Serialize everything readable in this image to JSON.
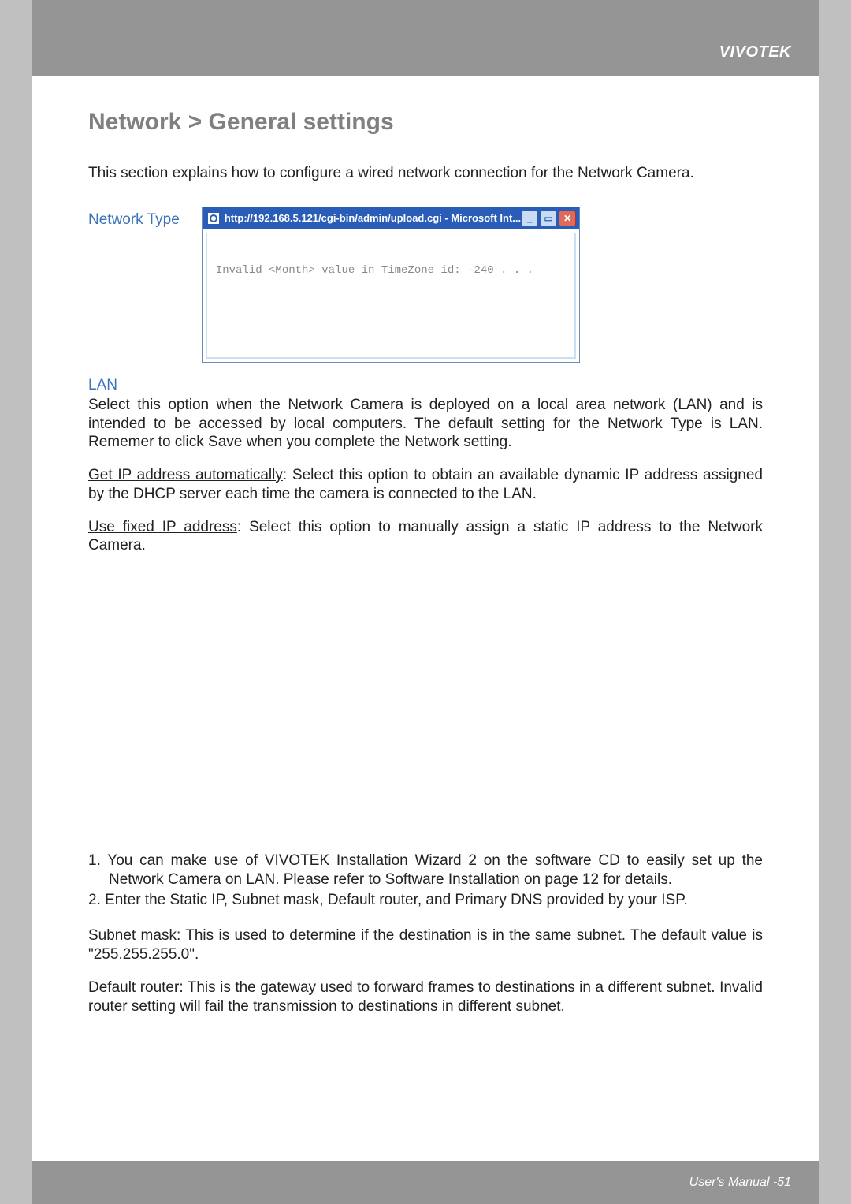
{
  "header": {
    "brand": "VIVOTEK"
  },
  "title": "Network > General settings",
  "intro": "This section explains how to configure a wired network connection for the Network Camera.",
  "network_type_label": "Network Type",
  "ie_window": {
    "title": "http://192.168.5.121/cgi-bin/admin/upload.cgi - Microsoft Int...",
    "body": "Invalid <Month> value in TimeZone id: -240 . . ."
  },
  "lan": {
    "heading": "LAN",
    "p1": "Select this option when the Network Camera is deployed on a local area network (LAN) and is intended to be accessed by local computers. The default setting for the Network Type is LAN. Rememer to click Save when you complete the Network setting.",
    "get_ip_label": "Get IP address automatically",
    "get_ip_rest": ": Select this option to obtain an available dynamic IP address assigned by the DHCP server each time the camera is connected to the LAN.",
    "fixed_ip_label": "Use fixed IP address",
    "fixed_ip_rest": ": Select this option to manually assign a static IP address to the Network Camera."
  },
  "numbered": {
    "item1": "1. You can make use of VIVOTEK Installation Wizard 2 on the software CD to easily set up the Network Camera on LAN. Please refer to Software Installation on page 12 for details.",
    "item2": "2. Enter the Static IP, Subnet mask, Default router, and Primary DNS provided by your ISP."
  },
  "subnet": {
    "label": "Subnet mask",
    "rest": ": This is used to determine if the destination is in the same subnet. The default value is \"255.255.255.0\"."
  },
  "router": {
    "label": "Default router",
    "rest": ": This is the gateway used to forward frames to destinations in a different subnet. Invalid router setting will fail the transmission to destinations in different subnet."
  },
  "footer": {
    "label": "User's Manual - ",
    "page": "51"
  }
}
